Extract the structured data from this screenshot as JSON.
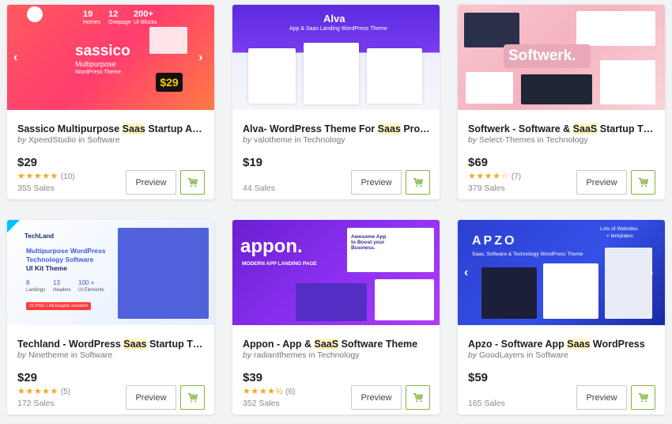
{
  "cards": [
    {
      "title_pre": "Sassico Multipurpose ",
      "title_hl": "Saas",
      "title_post": " Startup Agenc...",
      "by": "by",
      "author": "XpeedStudio",
      "in": "in",
      "category": "Software",
      "price": "$29",
      "stars": "★★★★★",
      "reviews": "(10)",
      "sales": "355 Sales",
      "thumb": {
        "brand": "sassico",
        "sub1": "Multipurpose",
        "sub2": "WordPress Theme",
        "badge": "$29",
        "stat1": "19",
        "stat1_label": "Homes",
        "stat2": "12",
        "stat2_label": "Onepage",
        "stat3": "200+",
        "stat3_label": "UI Blocks"
      }
    },
    {
      "title_pre": "Alva- WordPress Theme For ",
      "title_hl": "Saas",
      "title_post": " Product",
      "by": "by",
      "author": "valotheme",
      "in": "in",
      "category": "Technology",
      "price": "$19",
      "stars": "",
      "reviews": "",
      "sales": "44 Sales",
      "thumb": {
        "brand": "Alva",
        "sub1": "App & Saas Landing WordPress Theme"
      }
    },
    {
      "title_pre": "Softwerk - Software & ",
      "title_hl": "SaaS",
      "title_post": " Startup Theme",
      "by": "by",
      "author": "Select-Themes",
      "in": "in",
      "category": "Technology",
      "price": "$69",
      "stars": "★★★★☆",
      "reviews": "(7)",
      "sales": "379 Sales",
      "thumb": {
        "brand": "Softwerk."
      }
    },
    {
      "title_pre": "Techland - WordPress ",
      "title_hl": "Saas",
      "title_post": " Startup Theme",
      "by": "by",
      "author": "Ninetheme",
      "in": "in",
      "category": "Software",
      "price": "$29",
      "stars": "★★★★★",
      "reviews": "(5)",
      "sales": "172 Sales",
      "thumb": {
        "brand": "TechLand",
        "sub1": "Multipurpose WordPress",
        "sub2": "Technology Software",
        "sub3": "UI Kit Theme",
        "stat1": "8",
        "stat1_label": "Landings",
        "stat2": "13",
        "stat2_label": "Headers",
        "stat3": "100 +",
        "stat3_label": "UI Elements",
        "ribbon": "25 PSD + All Graphic included"
      }
    },
    {
      "title_pre": "Appon - App & ",
      "title_hl": "SaaS",
      "title_post": " Software Theme",
      "by": "by",
      "author": "radiantthemes",
      "in": "in",
      "category": "Technology",
      "price": "$39",
      "stars": "★★★★½",
      "reviews": "(6)",
      "sales": "352 Sales",
      "thumb": {
        "brand": "appon.",
        "sub1": "MODERN APP LANDING PAGE",
        "promo": "Awesome App to Boost your Business."
      }
    },
    {
      "title_pre": "Apzo - Software App ",
      "title_hl": "Saas",
      "title_post": " WordPress",
      "by": "by",
      "author": "GoodLayers",
      "in": "in",
      "category": "Software",
      "price": "$59",
      "stars": "",
      "reviews": "",
      "sales": "165 Sales",
      "thumb": {
        "brand": "APZO",
        "sub1": "Saas, Software & Technology WordPress Theme",
        "sub2": "Lots of Websites",
        "sub3": "+ templates"
      }
    }
  ],
  "labels": {
    "preview": "Preview"
  },
  "colors": {
    "accent_green": "#82b440",
    "star": "#f5a623"
  }
}
